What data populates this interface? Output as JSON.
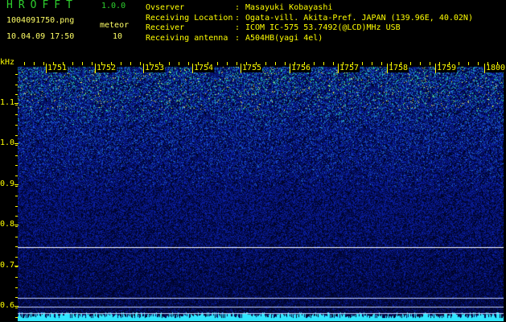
{
  "app": {
    "title": "HROFFT",
    "version": "1.0.0"
  },
  "file": {
    "name": "1004091750.png",
    "mode": "meteor",
    "datetime": "10.04.09 17:50",
    "count": "10"
  },
  "info": [
    {
      "label": "Ovserver",
      "value": "Masayuki Kobayashi"
    },
    {
      "label": "Receiving Location",
      "value": "Ogata-vill. Akita-Pref. JAPAN (139.96E, 40.02N)"
    },
    {
      "label": "Receiver",
      "value": "ICOM IC-575 53.7492(@LCD)MHz USB"
    },
    {
      "label": "Receiving antenna",
      "value": "A504HB(yagi 4el)"
    }
  ],
  "spectrogram": {
    "unit": "kHz",
    "time_labels": [
      "1751",
      "1752",
      "1753",
      "1754",
      "1755",
      "1756",
      "1757",
      "1758",
      "1759",
      "1800"
    ],
    "freq_labels": [
      "1.1",
      "1.0",
      "0.9",
      "0.8",
      "0.7",
      "0.6"
    ],
    "hlines_khz": [
      0.745,
      0.62,
      0.598,
      0.582
    ],
    "palette": {
      "background": "#000014",
      "low": "#0a1a9c",
      "mid": "#1e64d2",
      "high": "#28d2aa",
      "peak": "#ffff50",
      "label": "#ffff00"
    }
  }
}
